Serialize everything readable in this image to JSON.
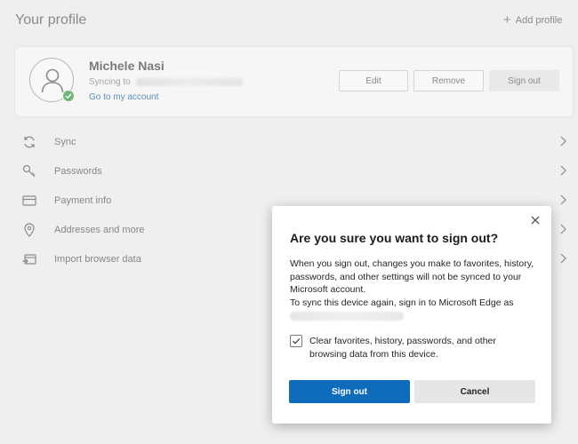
{
  "page": {
    "title": "Your profile",
    "add_profile_label": "Add profile"
  },
  "profile": {
    "name": "Michele Nasi",
    "syncing_label": "Syncing to",
    "account_link": "Go to my account",
    "buttons": {
      "edit": "Edit",
      "remove": "Remove",
      "sign_out": "Sign out"
    }
  },
  "menu": {
    "items": [
      {
        "label": "Sync",
        "icon": "sync-icon"
      },
      {
        "label": "Passwords",
        "icon": "key-icon"
      },
      {
        "label": "Payment info",
        "icon": "credit-card-icon"
      },
      {
        "label": "Addresses and more",
        "icon": "location-pin-icon"
      },
      {
        "label": "Import browser data",
        "icon": "import-icon"
      }
    ]
  },
  "dialog": {
    "title": "Are you sure you want to sign out?",
    "body_line1": "When you sign out, changes you make to favorites, history, passwords, and other settings will not be synced to your Microsoft account.",
    "body_line2": "To sync this device again, sign in to Microsoft Edge as",
    "checkbox_label": "Clear favorites, history, passwords, and other browsing data from this device.",
    "checkbox_checked": true,
    "primary_button": "Sign out",
    "secondary_button": "Cancel"
  },
  "colors": {
    "accent": "#0f6cbd",
    "sync_badge": "#6fb776",
    "link": "#5e8dbb"
  }
}
